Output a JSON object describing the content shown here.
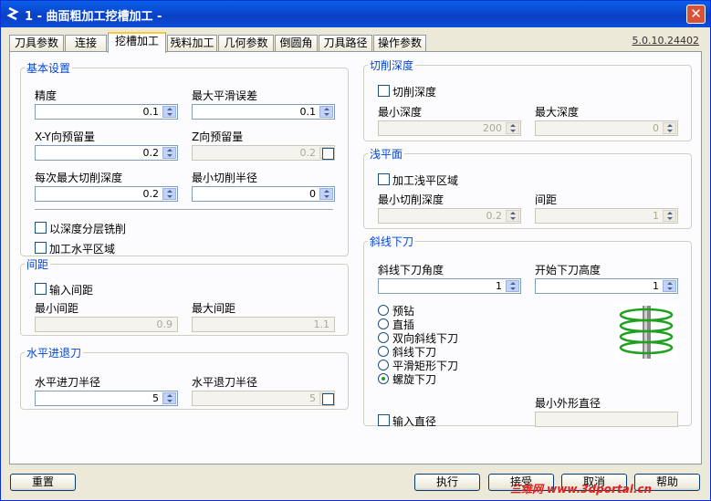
{
  "title": "1 - 曲面粗加工挖槽加工 -",
  "version": "5.0.10.24402",
  "tabs": [
    "刀具参数",
    "连接",
    "挖槽加工",
    "残料加工",
    "几何参数",
    "倒圆角",
    "刀具路径",
    "操作参数"
  ],
  "basic": {
    "legend": "基本设置",
    "precision_label": "精度",
    "precision_value": "0.1",
    "max_smooth_label": "最大平滑误差",
    "max_smooth_value": "0.1",
    "xy_allow_label": "X-Y向预留量",
    "xy_allow_value": "0.2",
    "z_allow_label": "Z向预留量",
    "z_allow_value": "0.2",
    "max_depth_label": "每次最大切削深度",
    "max_depth_value": "0.2",
    "min_radius_label": "最小切削半径",
    "min_radius_value": "0",
    "depth_layer_label": "以深度分层铣削",
    "horiz_area_label": "加工水平区域"
  },
  "spacing": {
    "legend": "间距",
    "input_label": "输入间距",
    "min_label": "最小间距",
    "min_value": "0.9",
    "max_label": "最大间距",
    "max_value": "1.1"
  },
  "lead": {
    "legend": "水平进退刀",
    "in_label": "水平进刀半径",
    "in_value": "5",
    "out_label": "水平退刀半径",
    "out_value": "5"
  },
  "cut_depth": {
    "legend": "切削深度",
    "check_label": "切削深度",
    "min_label": "最小深度",
    "min_value": "200",
    "max_label": "最大深度",
    "max_value": "0"
  },
  "shallow": {
    "legend": "浅平面",
    "check_label": "加工浅平区域",
    "min_label": "最小切削深度",
    "min_value": "0.2",
    "gap_label": "间距",
    "gap_value": "1"
  },
  "ramp": {
    "legend": "斜线下刀",
    "angle_label": "斜线下刀角度",
    "angle_value": "1",
    "start_label": "开始下刀高度",
    "start_value": "1",
    "options": [
      "预钻",
      "直插",
      "双向斜线下刀",
      "斜线下刀",
      "平滑矩形下刀",
      "螺旋下刀"
    ],
    "selected": "螺旋下刀",
    "input_dia_label": "输入直径",
    "min_dia_label": "最小外形直径"
  },
  "buttons": {
    "reset": "重置",
    "run": "执行",
    "ok": "接受",
    "cancel": "取消",
    "help": "帮助"
  },
  "watermark": "三维网 www.3dportal.cn",
  "colors": {
    "title_bar": "#0a47cf",
    "legend": "#0046d5",
    "tab_highlight": "#ffc83c"
  }
}
